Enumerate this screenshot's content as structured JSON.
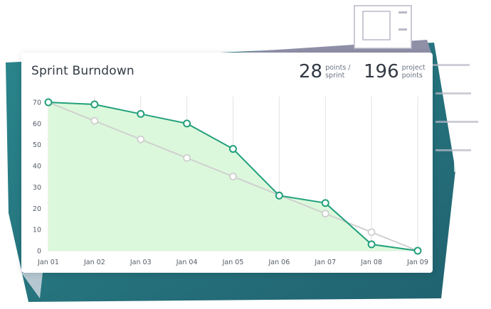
{
  "card": {
    "title": "Sprint Burndown",
    "stats": [
      {
        "value": "28",
        "label_line1": "points /",
        "label_line2": "sprint"
      },
      {
        "value": "196",
        "label_line1": "project",
        "label_line2": "points"
      }
    ]
  },
  "colors": {
    "actual_line": "#22a07b",
    "actual_fill": "#dcf8dc",
    "ideal_line": "#cfcfcf",
    "grid": "#e2e2e2",
    "backdrop_teal": "#1d6e78",
    "backdrop_purple": "#8f8fa8"
  },
  "chart_data": {
    "type": "line",
    "categories": [
      "Jan 01",
      "Jan 02",
      "Jan 03",
      "Jan 04",
      "Jan 05",
      "Jan 06",
      "Jan 07",
      "Jan 08",
      "Jan 09"
    ],
    "series": [
      {
        "values": [
          70,
          69,
          64.5,
          60,
          48,
          26,
          22.5,
          3,
          0
        ],
        "fill": true
      },
      {
        "values": [
          70,
          61.25,
          52.5,
          43.75,
          35,
          26.25,
          17.5,
          8.75,
          0
        ],
        "fill": false
      }
    ],
    "yticks": [
      0,
      10,
      20,
      30,
      40,
      50,
      60,
      70
    ],
    "ylim": [
      0,
      70
    ],
    "title": "",
    "xlabel": "",
    "ylabel": "",
    "grid": "vertical"
  }
}
